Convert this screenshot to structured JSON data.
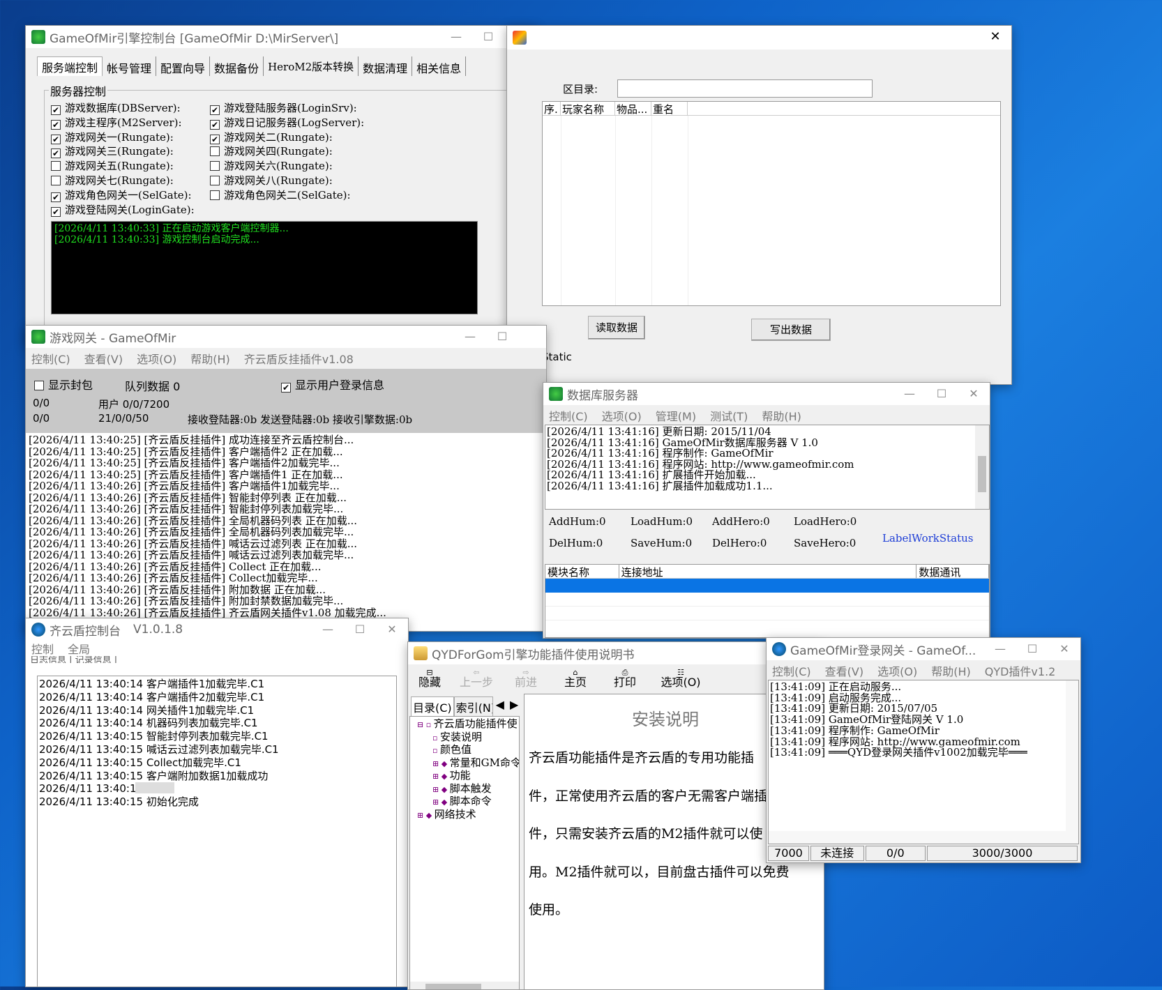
{
  "console": {
    "title": "GameOfMir引擎控制台 [GameOfMir D:\\MirServer\\]",
    "tabs": [
      "服务端控制",
      "帐号管理",
      "配置向导",
      "数据备份",
      "HeroM2版本转换",
      "数据清理",
      "相关信息"
    ],
    "group_label": "服务器控制",
    "checks_left": [
      {
        "label": "游戏数据库(DBServer):",
        "checked": true
      },
      {
        "label": "游戏主程序(M2Server):",
        "checked": true
      },
      {
        "label": "游戏网关一(Rungate):",
        "checked": true
      },
      {
        "label": "游戏网关三(Rungate):",
        "checked": true
      },
      {
        "label": "游戏网关五(Rungate):",
        "checked": false
      },
      {
        "label": "游戏网关七(Rungate):",
        "checked": false
      },
      {
        "label": "游戏角色网关一(SelGate):",
        "checked": true
      },
      {
        "label": "游戏登陆网关(LoginGate):",
        "checked": true
      }
    ],
    "checks_right": [
      {
        "label": "游戏登陆服务器(LoginSrv):",
        "checked": true
      },
      {
        "label": "游戏日记服务器(LogServer):",
        "checked": true
      },
      {
        "label": "游戏网关二(Rungate):",
        "checked": true
      },
      {
        "label": "游戏网关四(Rungate):",
        "checked": false
      },
      {
        "label": "游戏网关六(Rungate):",
        "checked": false
      },
      {
        "label": "游戏网关八(Rungate):",
        "checked": false
      },
      {
        "label": "游戏角色网关二(SelGate):",
        "checked": false
      }
    ],
    "log": [
      "[2026/4/11 13:40:33] 正在启动游戏客户端控制器...",
      "[2026/4/11 13:40:33] 游戏控制台启动完成..."
    ]
  },
  "dialog": {
    "label_dir": "区目录:",
    "cols": [
      "序.",
      "玩家名称",
      "物品...",
      "重名"
    ],
    "btn_read": "读取数据",
    "btn_write": "写出数据",
    "static": "Static"
  },
  "gateway": {
    "title": "游戏网关 - GameOfMir",
    "menu": [
      "控制(C)",
      "查看(V)",
      "选项(O)",
      "帮助(H)",
      "齐云盾反挂插件v1.08"
    ],
    "cb_show_packets": "显示封包",
    "queue": "队列数据 0",
    "cb_show_login": "显示用户登录信息",
    "stat1a": "0/0",
    "stat1b": "用户 0/0/7200",
    "stat2a": "0/0",
    "stat2b": "21/0/0/50",
    "stat2c": "接收登陆器:0b 发送登陆器:0b 接收引擎数据:0b",
    "log": [
      "[2026/4/11 13:40:25] [齐云盾反挂插件] 成功连接至齐云盾控制台...",
      "[2026/4/11 13:40:25] [齐云盾反挂插件] 客户端插件2 正在加载...",
      "[2026/4/11 13:40:25] [齐云盾反挂插件] 客户端插件2加载完毕...",
      "[2026/4/11 13:40:25] [齐云盾反挂插件] 客户端插件1 正在加载...",
      "[2026/4/11 13:40:26] [齐云盾反挂插件] 客户端插件1加载完毕...",
      "[2026/4/11 13:40:26] [齐云盾反挂插件] 智能封停列表 正在加载...",
      "[2026/4/11 13:40:26] [齐云盾反挂插件] 智能封停列表加载完毕...",
      "[2026/4/11 13:40:26] [齐云盾反挂插件] 全局机器码列表 正在加载...",
      "[2026/4/11 13:40:26] [齐云盾反挂插件] 全局机器码列表加载完毕...",
      "[2026/4/11 13:40:26] [齐云盾反挂插件] 喊话云过滤列表 正在加载...",
      "[2026/4/11 13:40:26] [齐云盾反挂插件] 喊话云过滤列表加载完毕...",
      "[2026/4/11 13:40:26] [齐云盾反挂插件] Collect 正在加载...",
      "[2026/4/11 13:40:26] [齐云盾反挂插件] Collect加载完毕...",
      "[2026/4/11 13:40:26] [齐云盾反挂插件] 附加数据 正在加载...",
      "[2026/4/11 13:40:26] [齐云盾反挂插件] 附加封禁数据加载完毕...",
      "[2026/4/11 13:40:26] [齐云盾反挂插件] 齐云盾网关插件v1.08 加载完成..."
    ]
  },
  "db": {
    "title": "数据库服务器",
    "menu": [
      "控制(C)",
      "选项(O)",
      "管理(M)",
      "测试(T)",
      "帮助(H)"
    ],
    "log": [
      "[2026/4/11 13:41:16] 更新日期: 2015/11/04",
      "[2026/4/11 13:41:16] GameOfMir数据库服务器 V 1.0",
      "[2026/4/11 13:41:16] 程序制作: GameOfMir",
      "[2026/4/11 13:41:16] 程序网站: http://www.gameofmir.com",
      "[2026/4/11 13:41:16] 扩展插件开始加载...",
      "[2026/4/11 13:41:16] 扩展插件加载成功1.1..."
    ],
    "stats": [
      "AddHum:0",
      "LoadHum:0",
      "AddHero:0",
      "LoadHero:0",
      "DelHum:0",
      "SaveHum:0",
      "DelHero:0",
      "SaveHero:0"
    ],
    "label_work": "LabelWorkStatus",
    "cols": [
      "模块名称",
      "连接地址",
      "数据通讯"
    ]
  },
  "qyd": {
    "title": "齐云盾控制台",
    "version": "V1.0.1.8",
    "menu": [
      "控制",
      "全局"
    ],
    "tabs": "日志信息 | 记录信息 |",
    "log": [
      "2026/4/11 13:40:14 客户端插件1加载完毕.C1",
      "2026/4/11 13:40:14 客户端插件2加载完毕.C1",
      "2026/4/11 13:40:14 网关插件1加载完毕.C1",
      "2026/4/11 13:40:14 机器码列表加载完毕.C1",
      "2026/4/11 13:40:15 智能封停列表加载完毕.C1",
      "2026/4/11 13:40:15 喊话云过滤列表加载完毕.C1",
      "2026/4/11 13:40:15 Collect加载完毕.C1",
      "2026/4/11 13:40:15 客户端附加数据1加载成功",
      "2026/4/11 13:40:15",
      "2026/4/11 13:40:15 初始化完成"
    ]
  },
  "help": {
    "title": "QYDForGom引擎功能插件使用说明书",
    "toolbar": [
      "隐藏",
      "上一步",
      "前进",
      "主页",
      "打印",
      "选项(O)"
    ],
    "tabs": [
      "目录(C)",
      "索引(N)"
    ],
    "tree": [
      "齐云盾功能插件使",
      "安装说明",
      "颜色值",
      "常量和GM命令",
      "功能",
      "脚本触发",
      "脚本命令",
      "网络技术"
    ],
    "heading": "安装说明",
    "para": [
      "齐云盾功能插件是齐云盾的专用功能插",
      "件，正常使用齐云盾的客户无需客户端插",
      "件，只需安装齐云盾的M2插件就可以使",
      "用。M2插件就可以，目前盘古插件可以免费",
      "使用。"
    ]
  },
  "login": {
    "title": "GameOfMir登录网关 - GameOf...",
    "menu": [
      "控制(C)",
      "查看(V)",
      "选项(O)",
      "帮助(H)",
      "QYD插件v1.2"
    ],
    "log": [
      "[13:41:09] 正在启动服务...",
      "[13:41:09] 启动服务完成...",
      "[13:41:09] 更新日期: 2015/07/05",
      "[13:41:09] GameOfMir登陆网关 V 1.0",
      "[13:41:09] 程序制作: GameOfMir",
      "[13:41:09] 程序网站: http://www.gameofmir.com",
      "[13:41:09] ═══QYD登录网关插件v1002加载完毕═══"
    ],
    "status": [
      "7000",
      "未连接",
      "0/0",
      "3000/3000"
    ]
  }
}
